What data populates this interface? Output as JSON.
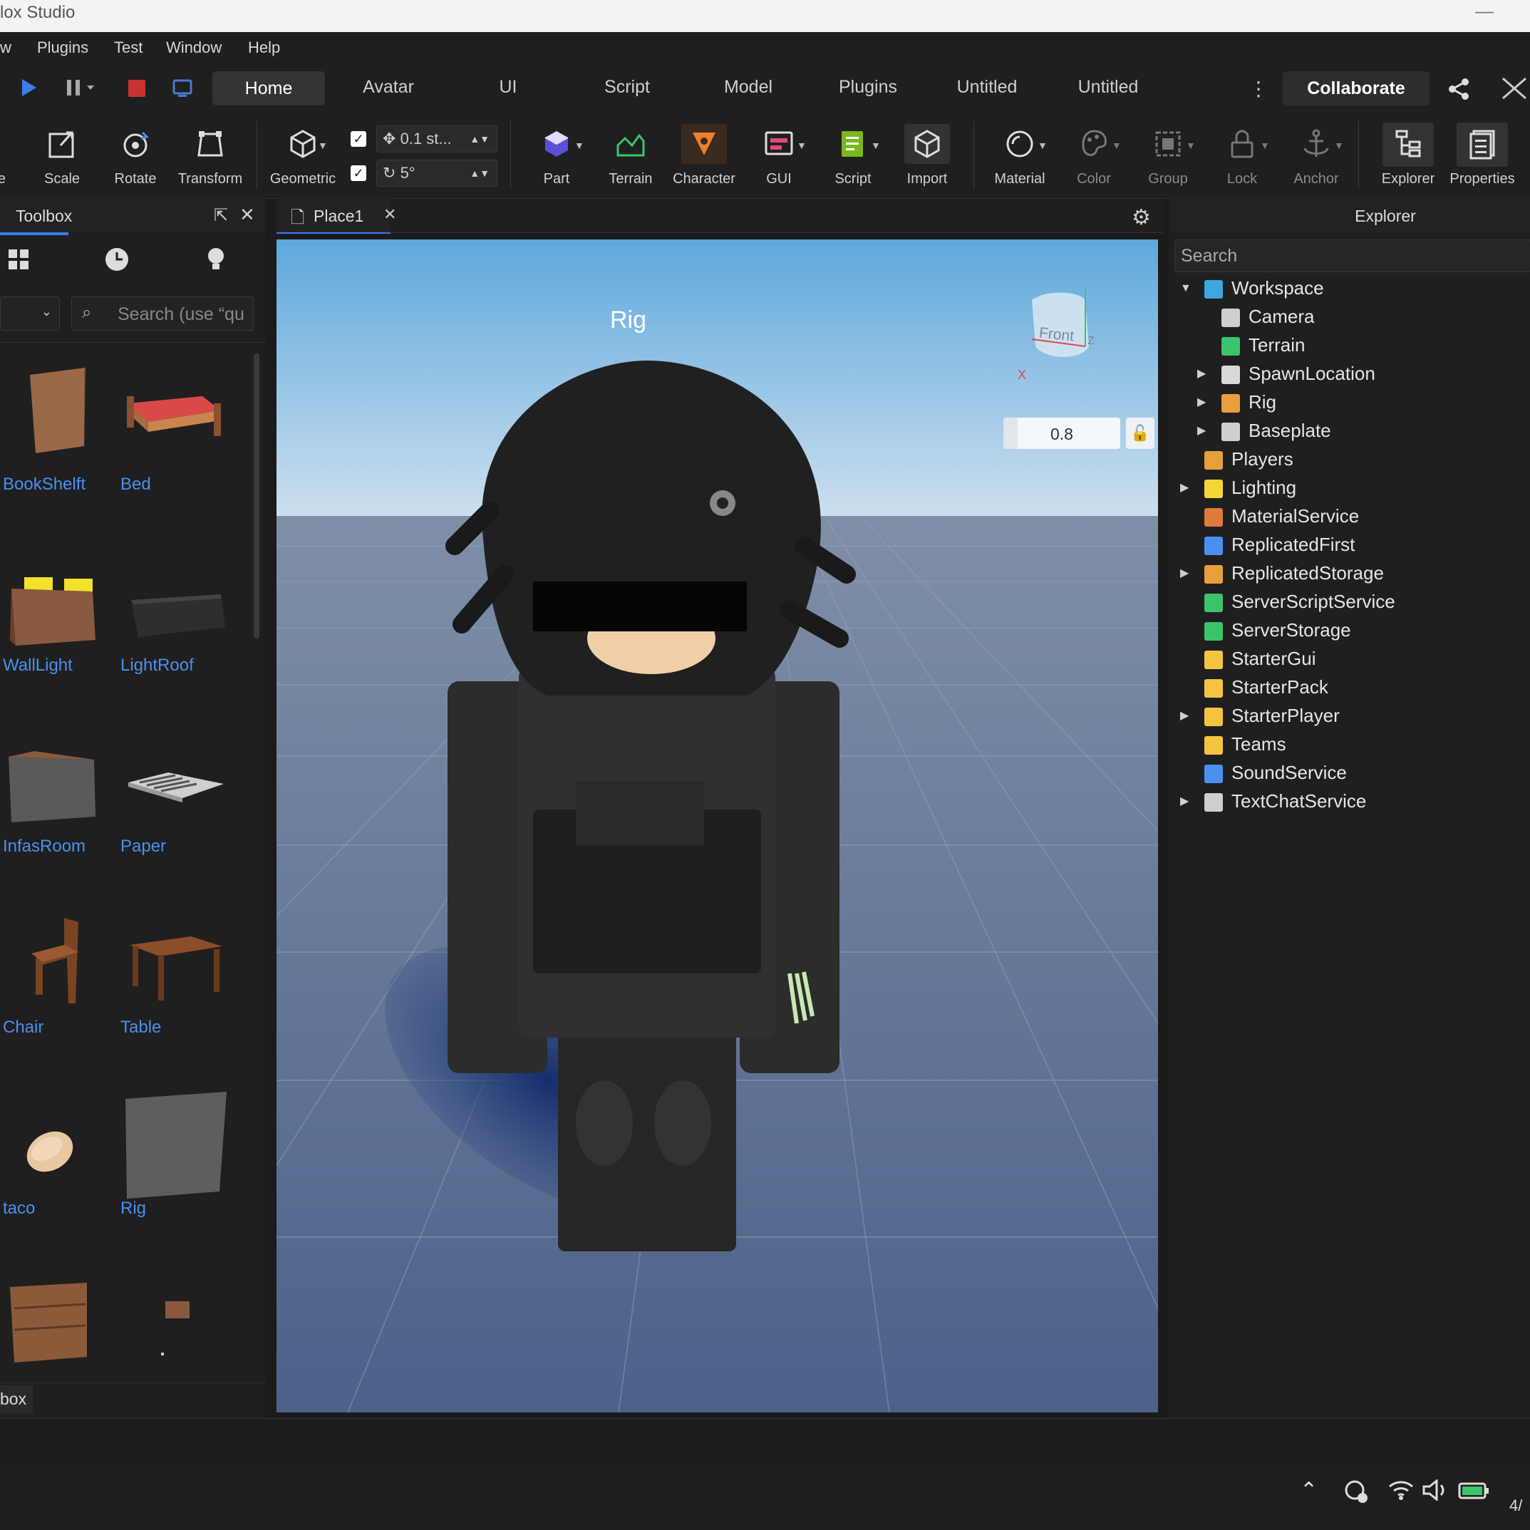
{
  "window": {
    "title": "lox Studio",
    "minimize": "—"
  },
  "menu": [
    "w",
    "Plugins",
    "Test",
    "Window",
    "Help"
  ],
  "tabs": {
    "items": [
      "Home",
      "Avatar",
      "UI",
      "Script",
      "Model",
      "Plugins",
      "Untitled",
      "Untitled"
    ],
    "active": "Home",
    "collaborate": "Collaborate"
  },
  "ribbon": {
    "tools_left": [
      "e",
      "Scale",
      "Rotate",
      "Transform"
    ],
    "geometric": "Geometric",
    "move_step": "0.1 st...",
    "rotate_step": "5°",
    "insert": [
      "Part",
      "Terrain",
      "Character",
      "GUI",
      "Script",
      "Import"
    ],
    "edit": [
      "Material",
      "Color",
      "Group",
      "Lock",
      "Anchor"
    ],
    "windows": [
      "Explorer",
      "Properties"
    ]
  },
  "toolbox": {
    "title": "Toolbox",
    "search_placeholder": "Search (use “qu",
    "items": [
      "BookShelft",
      "Bed",
      "WallLight",
      "LightRoof",
      "InfasRoom",
      "Paper",
      "Chair",
      "Table",
      "taco",
      "Rig",
      "",
      ""
    ],
    "footer": "box"
  },
  "viewport": {
    "tab": "Place1",
    "rig_label": "Rig",
    "viewcube_face": "Front",
    "axis_x": "X",
    "axis_z": "Z",
    "zoom_value": "0.8"
  },
  "explorer": {
    "title": "Explorer",
    "search_placeholder": "Search",
    "rows": [
      {
        "label": "Workspace",
        "depth": 0,
        "caret": "open",
        "color": "#3fa7e0"
      },
      {
        "label": "Camera",
        "depth": 1,
        "caret": "",
        "color": "#cfcfcf"
      },
      {
        "label": "Terrain",
        "depth": 1,
        "caret": "",
        "color": "#3cc46a"
      },
      {
        "label": "SpawnLocation",
        "depth": 1,
        "caret": "closed",
        "color": "#d9d9d9"
      },
      {
        "label": "Rig",
        "depth": 1,
        "caret": "closed",
        "color": "#e8a03a"
      },
      {
        "label": "Baseplate",
        "depth": 1,
        "caret": "closed",
        "color": "#cfcfcf"
      },
      {
        "label": "Players",
        "depth": 0,
        "caret": "",
        "color": "#e8a03a"
      },
      {
        "label": "Lighting",
        "depth": 0,
        "caret": "closed",
        "color": "#f5d63a"
      },
      {
        "label": "MaterialService",
        "depth": 0,
        "caret": "",
        "color": "#e07a3a"
      },
      {
        "label": "ReplicatedFirst",
        "depth": 0,
        "caret": "",
        "color": "#4a90f0"
      },
      {
        "label": "ReplicatedStorage",
        "depth": 0,
        "caret": "closed",
        "color": "#e8a03a"
      },
      {
        "label": "ServerScriptService",
        "depth": 0,
        "caret": "",
        "color": "#3cc46a"
      },
      {
        "label": "ServerStorage",
        "depth": 0,
        "caret": "",
        "color": "#3cc46a"
      },
      {
        "label": "StarterGui",
        "depth": 0,
        "caret": "",
        "color": "#f5c542"
      },
      {
        "label": "StarterPack",
        "depth": 0,
        "caret": "",
        "color": "#f5c542"
      },
      {
        "label": "StarterPlayer",
        "depth": 0,
        "caret": "closed",
        "color": "#f5c542"
      },
      {
        "label": "Teams",
        "depth": 0,
        "caret": "",
        "color": "#f5c542"
      },
      {
        "label": "SoundService",
        "depth": 0,
        "caret": "",
        "color": "#4a90f0"
      },
      {
        "label": "TextChatService",
        "depth": 0,
        "caret": "closed",
        "color": "#cfcfcf"
      }
    ]
  },
  "taskbar": {
    "clock": "4/"
  }
}
